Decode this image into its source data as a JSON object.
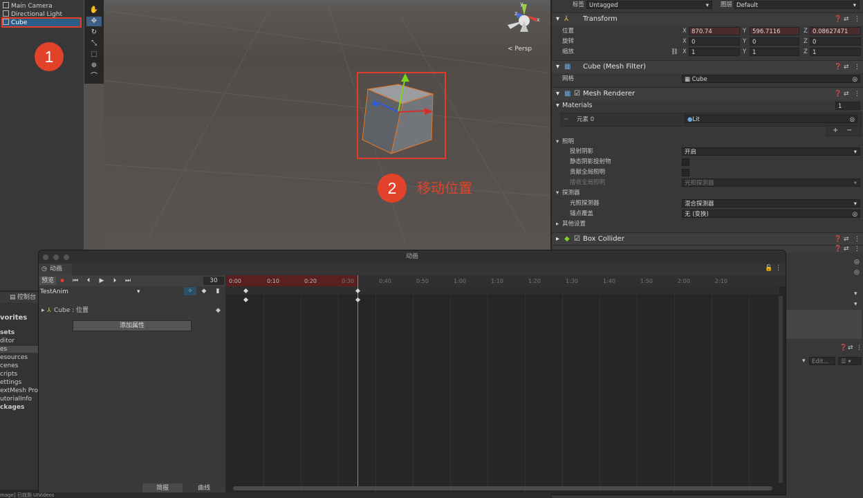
{
  "hierarchy": {
    "items": [
      "Main Camera",
      "Directional Light",
      "Cube"
    ],
    "selected": "Cube"
  },
  "annotations": {
    "step1": "1",
    "step2_num": "2",
    "step2_text": "移动位置"
  },
  "scene": {
    "view_label": "< Persp",
    "gizmo_axes": {
      "x": "x",
      "y": "y",
      "z": "z"
    }
  },
  "inspector": {
    "tag_label": "标签",
    "tag_value": "Untagged",
    "layer_label": "图层",
    "layer_value": "Default",
    "transform": {
      "title": "Transform",
      "position_label": "位置",
      "rotation_label": "旋转",
      "scale_label": "缩放",
      "position": {
        "x": "870.74",
        "y": "596.7116",
        "z": "0.08627471"
      },
      "rotation": {
        "x": "0",
        "y": "0",
        "z": "0"
      },
      "scale": {
        "x": "1",
        "y": "1",
        "z": "1"
      }
    },
    "mesh_filter": {
      "title": "Cube (Mesh Filter)",
      "mesh_label": "网格",
      "mesh_value": "Cube"
    },
    "mesh_renderer": {
      "title": "Mesh Renderer",
      "materials_label": "Materials",
      "materials_count": "1",
      "element_label": "元素 0",
      "element_value": "Lit",
      "lighting_label": "照明",
      "cast_shadows_label": "投射阴影",
      "cast_shadows_value": "开启",
      "static_shadow_label": "静态阴影投射物",
      "contribute_gi_label": "贡献全局照明",
      "receive_gi_label": "接收全局照明",
      "receive_gi_value": "光照探测器",
      "probes_label": "探测器",
      "light_probes_label": "光照探测器",
      "light_probes_value": "混合探测器",
      "anchor_label": "锚点覆盖",
      "anchor_value": "无 (变换)",
      "other_label": "其他设置"
    },
    "box_collider": {
      "title": "Box Collider"
    },
    "bottom_edit": "Edit..."
  },
  "console": {
    "tab_label": "控制台"
  },
  "project": {
    "items": [
      "vorites",
      "sets",
      "ditor",
      "es",
      "esources",
      "cenes",
      "cripts",
      "ettings",
      "extMesh Pro",
      "utorialInfo",
      "ckages"
    ]
  },
  "animation": {
    "window_title": "动画",
    "tab_label": "动画",
    "preview_label": "预览",
    "frame_value": "30",
    "clip_name": "TestAnim",
    "property_label": "Cube : 位置",
    "add_property_label": "添加属性",
    "dopesheet_label": "简报",
    "curves_label": "曲线",
    "ticks": [
      "0:00",
      "0:10",
      "0:20",
      "0:30",
      "0:40",
      "0:50",
      "1:00",
      "1:10",
      "1:20",
      "1:30",
      "1:40",
      "1:50",
      "2:00",
      "2:10"
    ]
  },
  "status": {
    "text": "mage] 已找到 UIVideos"
  }
}
